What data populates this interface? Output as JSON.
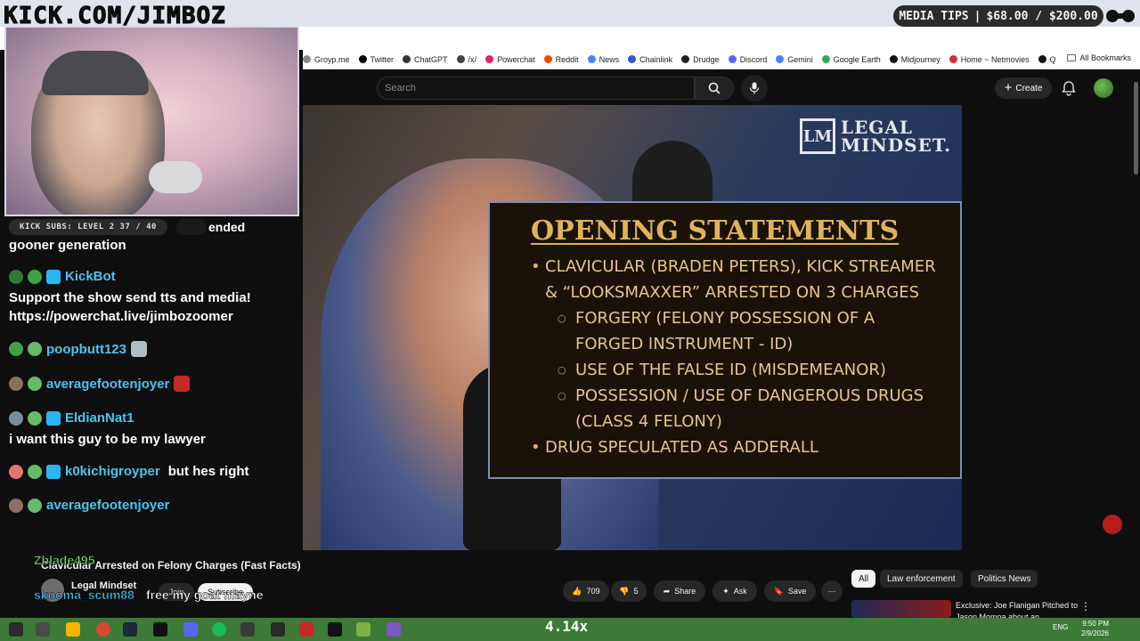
{
  "stream": {
    "logo_text": "KICK.COM/JIMBOZ",
    "media_tips_label": "MEDIA TIPS",
    "media_tips_amount": "$68.00 / $200.00",
    "subs_goal": "KICK SUBS: LEVEL 2 37 / 40",
    "subs_goal_suffix": "ended"
  },
  "browser": {
    "bookmarks": [
      {
        "label": "Groyp.me",
        "icon": "globe-icon",
        "color": "#888888"
      },
      {
        "label": "Twitter",
        "icon": "x-icon",
        "color": "#000000"
      },
      {
        "label": "ChatGPT",
        "icon": "chatgpt-icon",
        "color": "#333333"
      },
      {
        "label": "/x/",
        "icon": "grid-icon",
        "color": "#444444"
      },
      {
        "label": "Powerchat",
        "icon": "powerchat-icon",
        "color": "#e91e63"
      },
      {
        "label": "Reddit",
        "icon": "reddit-icon",
        "color": "#ff4500"
      },
      {
        "label": "News",
        "icon": "news-icon",
        "color": "#4285f4"
      },
      {
        "label": "Chainlink",
        "icon": "chainlink-icon",
        "color": "#2a5ada"
      },
      {
        "label": "Drudge",
        "icon": "drudge-icon",
        "color": "#222222"
      },
      {
        "label": "Discord",
        "icon": "discord-icon",
        "color": "#5865f2"
      },
      {
        "label": "Gemini",
        "icon": "gemini-icon",
        "color": "#4285f4"
      },
      {
        "label": "Google Earth",
        "icon": "google-earth-icon",
        "color": "#34a853"
      },
      {
        "label": "Midjourney",
        "icon": "midjourney-icon",
        "color": "#111111"
      },
      {
        "label": "Home ~ Netmovies",
        "icon": "netmovies-icon",
        "color": "#d32f2f"
      },
      {
        "label": "Q",
        "icon": "q-icon",
        "color": "#111111"
      }
    ],
    "all_bookmarks_label": "All Bookmarks"
  },
  "youtube": {
    "search_placeholder": "Search",
    "create_label": "Create",
    "video_title": "Clavicular Arrested on Felony Charges (Fast Facts)",
    "channel_name": "Legal Mindset",
    "join_label": "Join",
    "subscribe_label": "Subscribe",
    "likes": "709",
    "dislikes": "5",
    "share_label": "Share",
    "ask_label": "Ask",
    "save_label": "Save",
    "chips": [
      "All",
      "Law enforcement",
      "Politics News"
    ],
    "rec_title": "Exclusive: Joe Flanigan Pitched to Jason Momoa about an"
  },
  "slide": {
    "brand_line1": "LEGAL",
    "brand_line2": "MINDSET.",
    "title": "OPENING STATEMENTS",
    "bullet1_line1": "CLAVICULAR (BRADEN PETERS), KICK STREAMER",
    "bullet1_line2": "& “LOOKSMAXXER” ARRESTED ON 3 CHARGES",
    "sub1_line1": "FORGERY (FELONY POSSESSION OF A",
    "sub1_line2": "FORGED INSTRUMENT - ID)",
    "sub2": "USE OF THE FALSE ID (MISDEMEANOR)",
    "sub3_line1": "POSSESSION / USE OF DANGEROUS DRUGS",
    "sub3_line2": "(CLASS 4 FELONY)",
    "bullet2": "DRUG SPECULATED AS ADDERALL"
  },
  "chat": {
    "messages": [
      {
        "user": "",
        "text": "gooner generation"
      },
      {
        "user": "KickBot",
        "text": ""
      },
      {
        "user": "",
        "text": "Support the show send tts and media!"
      },
      {
        "user": "",
        "text": "https://powerchat.live/jimbozoomer"
      },
      {
        "user": "poopbutt123",
        "text": ""
      },
      {
        "user": "averagefootenjoyer",
        "text": ""
      },
      {
        "user": "EldianNat1",
        "text": ""
      },
      {
        "user": "",
        "text": "i want this guy to be my lawyer"
      },
      {
        "user": "k0kichigroyper",
        "text": "but hes right"
      },
      {
        "user": "averagefootenjoyer",
        "text": ""
      }
    ],
    "bottom_user_1": "Zblade495",
    "bottom_user_2": "skooma_scum88",
    "bottom_text_2": "free my goat mayne"
  },
  "taskbar": {
    "center_text": "4.14x",
    "lang": "ENG",
    "time": "9:50 PM",
    "date": "2/9/2026"
  }
}
